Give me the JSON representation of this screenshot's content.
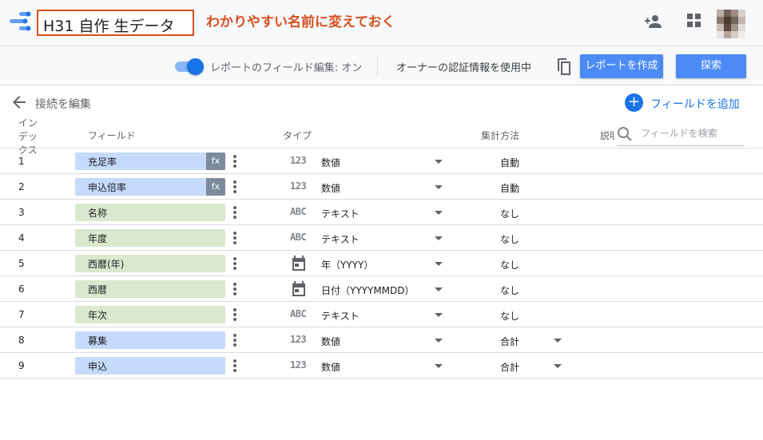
{
  "header": {
    "title": "H31 自作 生データ",
    "annotation": "わかりやすい名前に変えておく"
  },
  "toolbar": {
    "field_edit_toggle_label": "レポートのフィールド編集: オン",
    "field_edit_toggle_on": true,
    "owner_credentials": "オーナーの認証情報を使用中",
    "create_report_label": "レポートを作成",
    "explore_label": "探索"
  },
  "subbar": {
    "edit_connection_label": "接続を編集",
    "add_field_label": "フィールドを追加"
  },
  "table": {
    "headers": {
      "index": "インデックス",
      "field": "フィールド",
      "type": "タイプ",
      "aggregation": "集計方法",
      "description": "説明"
    },
    "search_placeholder": "フィールドを検索",
    "rows": [
      {
        "index": "1",
        "name": "充足率",
        "kind": "metric",
        "fx": "fx",
        "type_glyph": "123",
        "type_icon": "number-icon",
        "type": "数値",
        "aggregation": "自動",
        "agg_dropdown": false
      },
      {
        "index": "2",
        "name": "申込倍率",
        "kind": "metric",
        "fx": "fx",
        "type_glyph": "123",
        "type_icon": "number-icon",
        "type": "数値",
        "aggregation": "自動",
        "agg_dropdown": false
      },
      {
        "index": "3",
        "name": "名称",
        "kind": "dimension",
        "fx": "",
        "type_glyph": "ABC",
        "type_icon": "text-icon",
        "type": "テキスト",
        "aggregation": "なし",
        "agg_dropdown": false
      },
      {
        "index": "4",
        "name": "年度",
        "kind": "dimension",
        "fx": "",
        "type_glyph": "ABC",
        "type_icon": "text-icon",
        "type": "テキスト",
        "aggregation": "なし",
        "agg_dropdown": false
      },
      {
        "index": "5",
        "name": "西暦(年)",
        "kind": "dimension",
        "fx": "",
        "type_glyph": "",
        "type_icon": "calendar-icon",
        "type": "年（YYYY）",
        "aggregation": "なし",
        "agg_dropdown": false
      },
      {
        "index": "6",
        "name": "西暦",
        "kind": "dimension",
        "fx": "",
        "type_glyph": "",
        "type_icon": "calendar-icon",
        "type": "日付（YYYYMMDD）",
        "aggregation": "なし",
        "agg_dropdown": false
      },
      {
        "index": "7",
        "name": "年次",
        "kind": "dimension",
        "fx": "",
        "type_glyph": "ABC",
        "type_icon": "text-icon",
        "type": "テキスト",
        "aggregation": "なし",
        "agg_dropdown": false
      },
      {
        "index": "8",
        "name": "募集",
        "kind": "metric",
        "fx": "",
        "type_glyph": "123",
        "type_icon": "number-icon",
        "type": "数値",
        "aggregation": "合計",
        "agg_dropdown": true
      },
      {
        "index": "9",
        "name": "申込",
        "kind": "metric",
        "fx": "",
        "type_glyph": "123",
        "type_icon": "number-icon",
        "type": "数値",
        "aggregation": "合計",
        "agg_dropdown": true
      }
    ]
  },
  "colors": {
    "accent": "#1a73e8",
    "button": "#4c8bf5",
    "annotation": "#d84f1f",
    "metric_chip": "#c6dafc",
    "dimension_chip": "#d9e8ce"
  }
}
